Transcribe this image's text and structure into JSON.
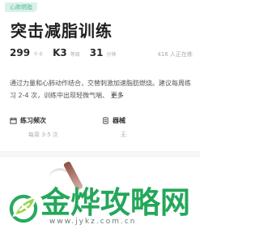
{
  "tag": "心肺燃脂",
  "title": "突击减脂训练",
  "stats": [
    {
      "value": "299",
      "unit": "千卡"
    },
    {
      "value": "K3",
      "unit": "等级"
    },
    {
      "value": "31",
      "unit": "分钟"
    }
  ],
  "participants": "416 人正在练",
  "description": {
    "text": "通过力量和心肺动作结合，交替刺激加速脂肪燃烧。建议每周练习 2-4 次，训练中出现轻微气喘、",
    "more": "更多"
  },
  "info": [
    {
      "label": "练习频次",
      "value": "每周 3-5 次",
      "icon": "calendar-icon"
    },
    {
      "label": "器械",
      "value": "无",
      "icon": "equipment-icon"
    }
  ],
  "watermark": {
    "brand": "金烨攻略网",
    "url": "www.jykz.com.cn"
  },
  "colors": {
    "tag_bg": "#d8f2ea",
    "tag_text": "#5bb99a",
    "brand_green": "#24a75a"
  }
}
